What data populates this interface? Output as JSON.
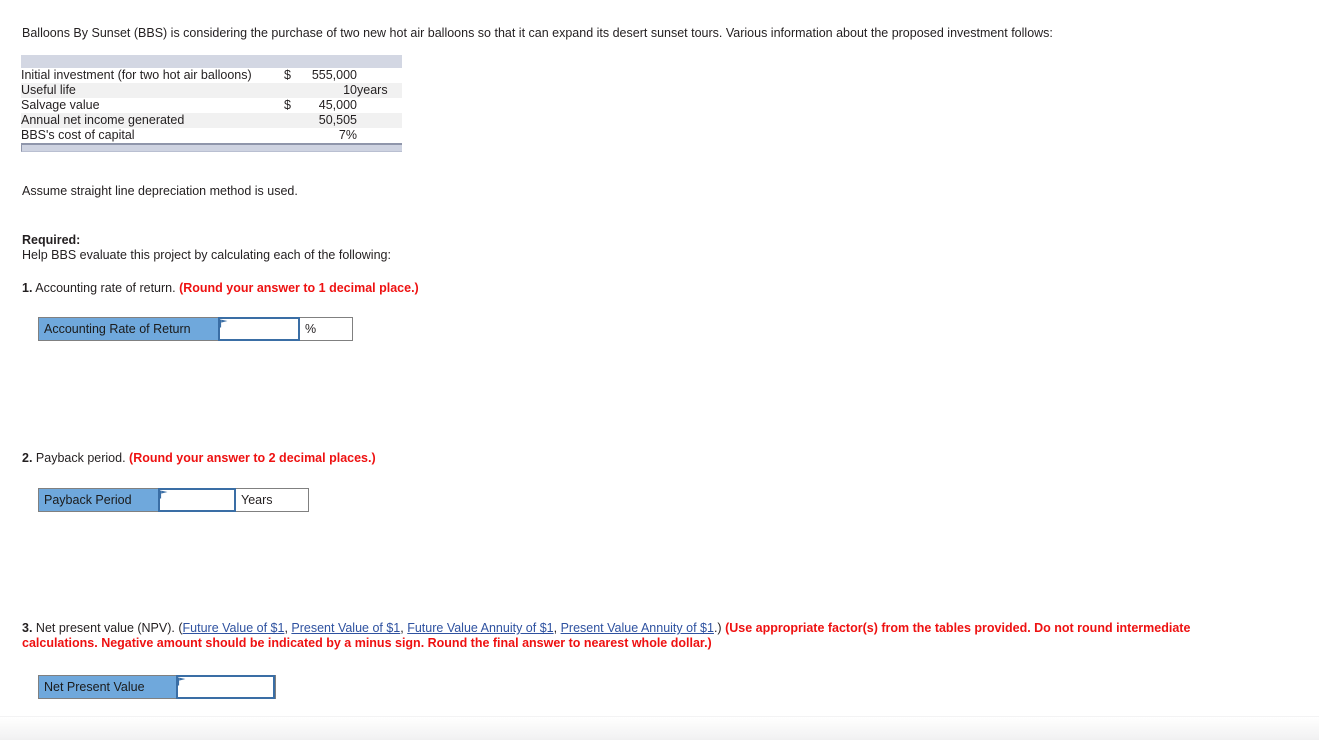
{
  "intro": {
    "text": "Balloons By Sunset (BBS) is considering the purchase of two new hot air balloons so that it can expand its desert sunset tours. Various information about the proposed investment follows:"
  },
  "facts_table": {
    "rows": [
      {
        "label": "Initial investment (for two hot air balloons)",
        "currency": "$",
        "value": "555,000",
        "unit": ""
      },
      {
        "label": "Useful life",
        "currency": "",
        "value": "10",
        "unit": "years"
      },
      {
        "label": "Salvage value",
        "currency": "$",
        "value": "45,000",
        "unit": ""
      },
      {
        "label": "Annual net income generated",
        "currency": "",
        "value": "50,505",
        "unit": ""
      },
      {
        "label": "BBS's cost of capital",
        "currency": "",
        "value": "7%",
        "unit": ""
      }
    ]
  },
  "assumption": "Assume straight line depreciation method is used.",
  "required": {
    "label": "Required:",
    "text": "Help BBS evaluate this project by calculating each of the following:"
  },
  "questions": {
    "q1": {
      "number": "1.",
      "text": "Accounting rate of return.",
      "instruction": "(Round your answer to 1 decimal place.)"
    },
    "q2": {
      "number": "2.",
      "text": "Payback period.",
      "instruction": "(Round your answer to 2 decimal places.)"
    },
    "q3": {
      "number": "3.",
      "text": "Net present value (NPV). (",
      "links": [
        "Future Value of $1",
        "Present Value of $1",
        "Future Value Annuity of $1",
        "Present Value Annuity of $1"
      ],
      "sep": ", ",
      "close": ".)",
      "instruction": "(Use appropriate factor(s) from the tables provided. Do not round intermediate calculations. Negative amount should be indicated by a minus sign. Round the final answer to nearest whole dollar.)"
    }
  },
  "answers": {
    "a1": {
      "label": "Accounting Rate of Return",
      "value": "",
      "unit": "%"
    },
    "a2": {
      "label": "Payback Period",
      "value": "",
      "unit": "Years"
    },
    "a3": {
      "label": "Net Present Value",
      "value": ""
    }
  },
  "colors": {
    "label_blue": "#6fa8dc",
    "input_border": "#3a6ea5",
    "table_header": "#d3d7e3",
    "table_footer": "#ced3e1",
    "row_alt": "#f1f1f1",
    "red": "#ee1111",
    "link": "#2f52a0"
  }
}
